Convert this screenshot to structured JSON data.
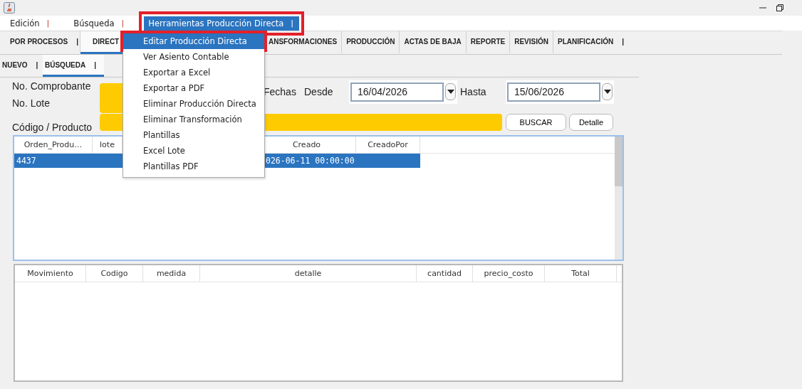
{
  "menu_bar": [
    {
      "label": "Edición",
      "separator": "|",
      "selected": false,
      "highlighted": false
    },
    {
      "label": "Búsqueda",
      "separator": "|",
      "selected": false,
      "highlighted": false
    },
    {
      "label": "Herramientas Producción Directa",
      "separator": "|",
      "selected": true,
      "highlighted": true
    }
  ],
  "dropdown": {
    "items": [
      {
        "label": "Editar Producción Directa",
        "selected": true,
        "highlighted": true
      },
      {
        "label": "Ver Asiento Contable",
        "selected": false,
        "highlighted": false
      },
      {
        "label": "Exportar a Excel",
        "selected": false,
        "highlighted": false
      },
      {
        "label": "Exportar a PDF",
        "selected": false,
        "highlighted": false
      },
      {
        "label": "Eliminar Producción Directa",
        "selected": false,
        "highlighted": false
      },
      {
        "label": "Eliminar Transformación",
        "selected": false,
        "highlighted": false
      },
      {
        "label": "Plantillas",
        "selected": false,
        "highlighted": false
      },
      {
        "label": "Excel Lote",
        "selected": false,
        "highlighted": false
      },
      {
        "label": "Plantillas PDF",
        "selected": false,
        "highlighted": false
      }
    ]
  },
  "tabs": [
    {
      "label": "POR PROCESOS",
      "separator": "|",
      "selected": false
    },
    {
      "label": "DIRECT",
      "selected": true
    },
    {
      "label": "ANSFORMACIONES",
      "selected": false
    },
    {
      "label": "PRODUCCIÓN",
      "selected": false
    },
    {
      "label": "ACTAS DE BAJA",
      "selected": false
    },
    {
      "label": "REPORTE",
      "selected": false
    },
    {
      "label": "REVISIÓN",
      "selected": false
    },
    {
      "label": "PLANIFICACIÓN",
      "separator": "|",
      "selected": false
    }
  ],
  "subtabs": [
    {
      "label": "NUEVO",
      "separator": "|",
      "selected": false
    },
    {
      "label": "BÚSQUEDA",
      "separator": "|",
      "selected": true
    }
  ],
  "form": {
    "comprobante_label": "No. Comprobante",
    "lote_label": "No. Lote",
    "codigo_label": "Código / Producto",
    "fechas_label": "Fechas",
    "desde_label": "Desde",
    "desde_value": "16/04/2026",
    "hasta_label": "Hasta",
    "hasta_value": "15/06/2026",
    "buttons": [
      "BUSCAR",
      "Detalle"
    ]
  },
  "results_table": {
    "columns": [
      "Orden_Produ…",
      "lote",
      "Creado",
      "CreadoPor"
    ],
    "rows": [
      {
        "cells": [
          "4437",
          "",
          "026-06-11 00:00:00"
        ],
        "selected": true
      }
    ]
  },
  "detail_table": {
    "columns": [
      "Movimiento",
      "Codigo",
      "medida",
      "detalle",
      "cantidad",
      "precio_costo",
      "Total"
    ]
  }
}
